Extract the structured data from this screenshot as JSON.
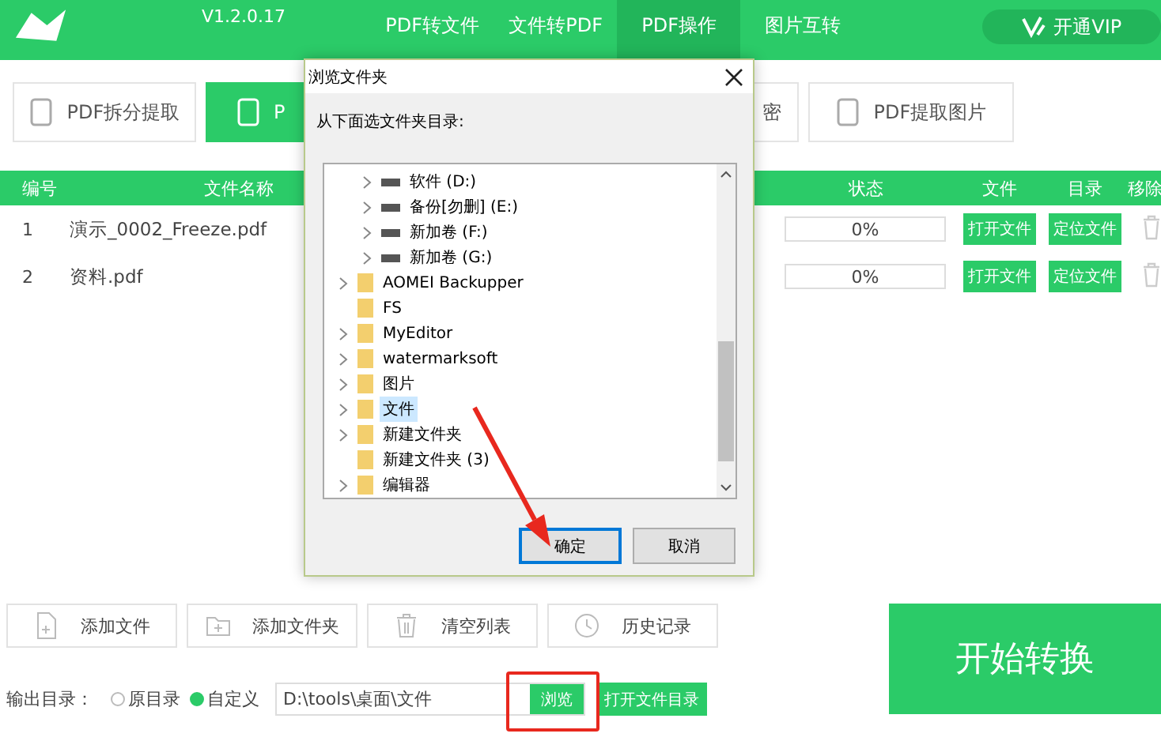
{
  "app": {
    "version": "V1.2.0.17"
  },
  "nav_tabs": [
    {
      "label": "PDF转文件",
      "selected": false
    },
    {
      "label": "文件转PDF",
      "selected": false
    },
    {
      "label": "PDF操作",
      "selected": true
    },
    {
      "label": "图片互转",
      "selected": false
    }
  ],
  "vip_button": {
    "label": "开通VIP"
  },
  "tool_buttons": [
    {
      "label": "PDF拆分提取",
      "selected": false
    },
    {
      "label": "P",
      "selected": true
    },
    {
      "label": "密",
      "selected": false
    },
    {
      "label": "PDF提取图片",
      "selected": false
    }
  ],
  "table": {
    "columns": [
      "编号",
      "文件名称",
      "状态",
      "文件",
      "目录",
      "移除"
    ],
    "rows": [
      {
        "index": "1",
        "name": "演示_0002_Freeze.pdf",
        "level": 0,
        "reading": "0%",
        "open_label": "打开文件",
        "locate_label": "定位文件"
      },
      {
        "index": "2",
        "name": "资料.pdf",
        "level": 0,
        "reading": "0%",
        "open_label": "打开文件",
        "locate_label": "定位文件"
      }
    ]
  },
  "actions": [
    "添加文件",
    "添加文件夹",
    "清空列表",
    "历史记录"
  ],
  "output": {
    "label": "输出目录：",
    "options": [
      {
        "label": "原目录",
        "selected": false
      },
      {
        "label": "自定义",
        "selected": true
      }
    ],
    "path": "D:\\tools\\桌面\\文件",
    "browse_label": "浏览",
    "open_dir_label": "打开文件目录"
  },
  "start_button": {
    "label": "开始转换"
  },
  "dialog": {
    "title": "浏览文件夹",
    "prompt": "从下面选文件夹目录:",
    "tree": [
      {
        "kind": "drive",
        "label": "软件 (D:)",
        "expandable": true,
        "selected": false
      },
      {
        "kind": "drive",
        "label": "备份[勿删] (E:)",
        "expandable": true,
        "selected": false
      },
      {
        "kind": "drive",
        "label": "新加卷 (F:)",
        "expandable": true,
        "selected": false
      },
      {
        "kind": "drive",
        "label": "新加卷 (G:)",
        "expandable": true,
        "selected": false
      },
      {
        "kind": "folder",
        "label": "AOMEI Backupper",
        "expandable": true,
        "selected": false
      },
      {
        "kind": "folder",
        "label": "FS",
        "expandable": false,
        "selected": false
      },
      {
        "kind": "folder",
        "label": "MyEditor",
        "expandable": true,
        "selected": false
      },
      {
        "kind": "folder",
        "label": "watermarksoft",
        "expandable": true,
        "selected": false
      },
      {
        "kind": "folder",
        "label": "图片",
        "expandable": true,
        "selected": false
      },
      {
        "kind": "folder",
        "label": "文件",
        "expandable": true,
        "selected": true
      },
      {
        "kind": "folder",
        "label": "新建文件夹",
        "expandable": true,
        "selected": false
      },
      {
        "kind": "folder",
        "label": "新建文件夹 (3)",
        "expandable": false,
        "selected": false
      },
      {
        "kind": "folder",
        "label": "编辑器",
        "expandable": true,
        "selected": false
      }
    ],
    "buttons": [
      {
        "label": "确定",
        "focused": true
      },
      {
        "label": "取消",
        "focused": false
      }
    ]
  }
}
